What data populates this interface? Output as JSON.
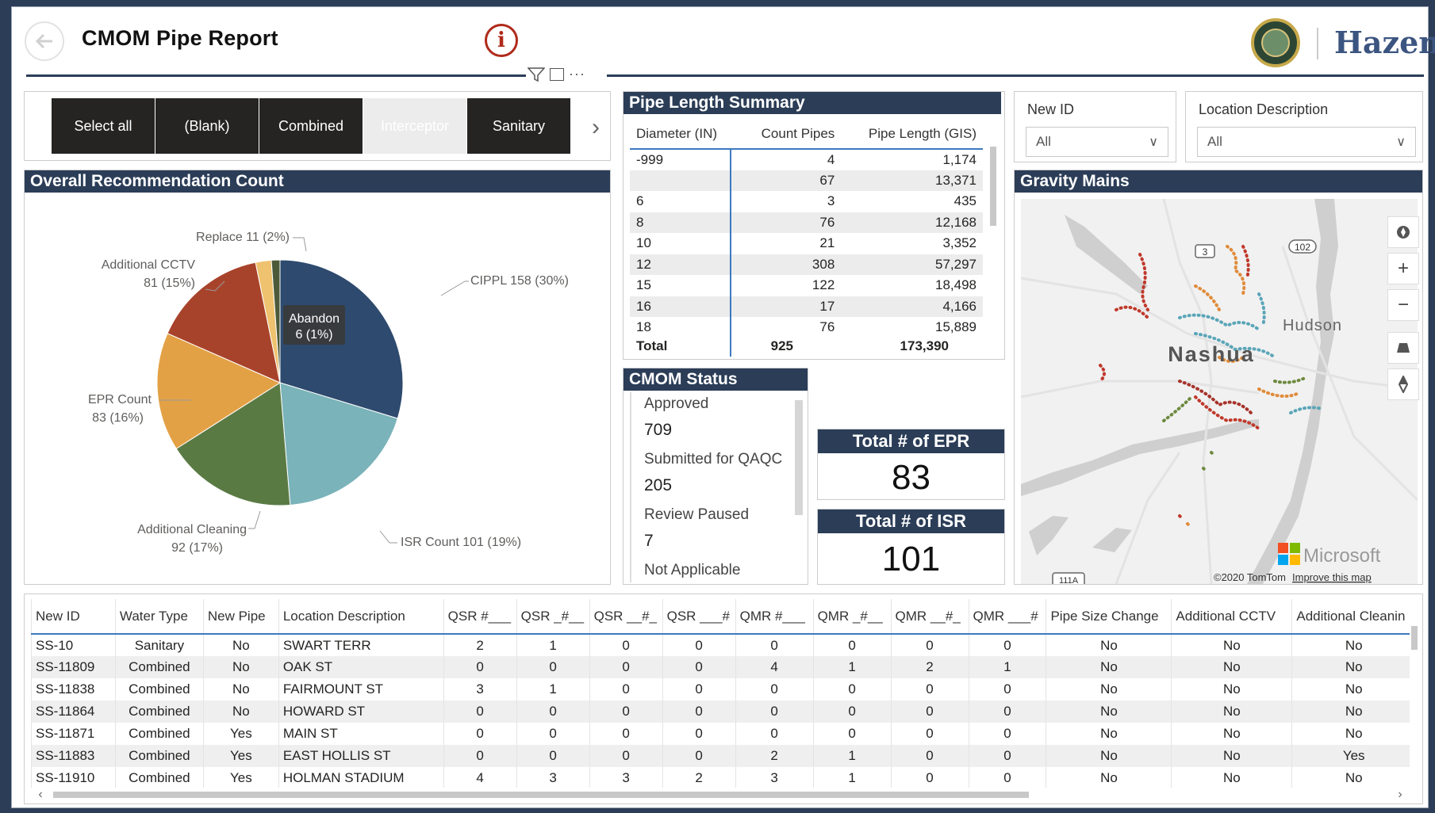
{
  "header": {
    "title": "CMOM Pipe Report",
    "logo_text": "Hazen",
    "info_icon": "info-circle-icon",
    "back_icon": "back-arrow-icon",
    "visual_menu": "···"
  },
  "water_type_slicer": {
    "options": [
      {
        "label": "Select all",
        "selected": true
      },
      {
        "label": "(Blank)",
        "selected": true
      },
      {
        "label": "Combined",
        "selected": true
      },
      {
        "label": "Interceptor",
        "selected": false
      },
      {
        "label": "Sanitary",
        "selected": true
      }
    ]
  },
  "pipe_length_summary": {
    "title": "Pipe Length Summary",
    "columns": [
      "Diameter (IN)",
      "Count Pipes",
      "Pipe Length (GIS)"
    ],
    "rows": [
      [
        "-999",
        "4",
        "1,174"
      ],
      [
        "",
        "67",
        "13,371"
      ],
      [
        "6",
        "3",
        "435"
      ],
      [
        "8",
        "76",
        "12,168"
      ],
      [
        "10",
        "21",
        "3,352"
      ],
      [
        "12",
        "308",
        "57,297"
      ],
      [
        "15",
        "122",
        "18,498"
      ],
      [
        "16",
        "17",
        "4,166"
      ],
      [
        "18",
        "76",
        "15,889"
      ]
    ],
    "total": [
      "Total",
      "925",
      "173,390"
    ]
  },
  "filters": {
    "new_id": {
      "label": "New ID",
      "value": "All"
    },
    "location_description": {
      "label": "Location Description",
      "value": "All"
    }
  },
  "recommendation": {
    "title": "Overall Recommendation Count",
    "tooltip_name": "Abandon",
    "tooltip_value": "6 (1%)",
    "labels": {
      "cippl": "CIPPL 158 (30%)",
      "isr": "ISR Count 101 (19%)",
      "cleaning_1": "Additional Cleaning",
      "cleaning_2": "92 (17%)",
      "epr_1": "EPR Count",
      "epr_2": "83 (16%)",
      "cctv_1": "Additional CCTV",
      "cctv_2": "81 (15%)",
      "replace": "Replace 11 (2%)"
    }
  },
  "chart_data": {
    "type": "pie",
    "title": "Overall Recommendation Count",
    "slices": [
      {
        "label": "CIPPL",
        "value": 158,
        "percent": 30,
        "color": "#2e4a6e"
      },
      {
        "label": "ISR Count",
        "value": 101,
        "percent": 19,
        "color": "#7ab3b9"
      },
      {
        "label": "Additional Cleaning",
        "value": 92,
        "percent": 17,
        "color": "#5a7a44"
      },
      {
        "label": "EPR Count",
        "value": 83,
        "percent": 16,
        "color": "#e3a145"
      },
      {
        "label": "Additional CCTV",
        "value": 81,
        "percent": 15,
        "color": "#a8432b"
      },
      {
        "label": "Replace",
        "value": 11,
        "percent": 2,
        "color": "#efc270"
      },
      {
        "label": "Abandon",
        "value": 6,
        "percent": 1,
        "color": "#4d5a3a"
      }
    ]
  },
  "cmom_status": {
    "title": "CMOM Status",
    "items": [
      {
        "label": "Approved",
        "value": "709"
      },
      {
        "label": "Submitted for QAQC",
        "value": "205"
      },
      {
        "label": "Review Paused",
        "value": "7"
      },
      {
        "label": "Not Applicable",
        "value": ""
      }
    ]
  },
  "cards": {
    "epr": {
      "title": "Total # of EPR",
      "value": "83"
    },
    "isr": {
      "title": "Total # of ISR",
      "value": "101"
    }
  },
  "map": {
    "title": "Gravity Mains",
    "city": "Nashua",
    "town": "Hudson",
    "road_3": "3",
    "road_102": "102",
    "road_111a": "111A",
    "brand": "Microsoft",
    "attribution": "©2020 TomTom",
    "improve_link": "Improve this map",
    "controls": [
      "+",
      "−"
    ]
  },
  "data_table": {
    "columns": [
      "New ID",
      "Water Type",
      "New Pipe",
      "Location Description",
      "QSR #___",
      "QSR _#__",
      "QSR __#_",
      "QSR ___#",
      "QMR #___",
      "QMR _#__",
      "QMR __#_",
      "QMR ___#",
      "Pipe Size Change",
      "Additional CCTV",
      "Additional Cleanin"
    ],
    "rows": [
      [
        "SS-10",
        "Sanitary",
        "No",
        "SWART TERR",
        "2",
        "1",
        "0",
        "0",
        "0",
        "0",
        "0",
        "0",
        "No",
        "No",
        "No"
      ],
      [
        "SS-11809",
        "Combined",
        "No",
        "OAK ST",
        "0",
        "0",
        "0",
        "0",
        "4",
        "1",
        "2",
        "1",
        "No",
        "No",
        "No"
      ],
      [
        "SS-11838",
        "Combined",
        "No",
        "FAIRMOUNT ST",
        "3",
        "1",
        "0",
        "0",
        "0",
        "0",
        "0",
        "0",
        "No",
        "No",
        "No"
      ],
      [
        "SS-11864",
        "Combined",
        "No",
        "HOWARD ST",
        "0",
        "0",
        "0",
        "0",
        "0",
        "0",
        "0",
        "0",
        "No",
        "No",
        "No"
      ],
      [
        "SS-11871",
        "Combined",
        "Yes",
        "MAIN ST",
        "0",
        "0",
        "0",
        "0",
        "0",
        "0",
        "0",
        "0",
        "No",
        "No",
        "No"
      ],
      [
        "SS-11883",
        "Combined",
        "Yes",
        "EAST HOLLIS ST",
        "0",
        "0",
        "0",
        "0",
        "2",
        "1",
        "0",
        "0",
        "No",
        "No",
        "Yes"
      ],
      [
        "SS-11910",
        "Combined",
        "Yes",
        "HOLMAN STADIUM",
        "4",
        "3",
        "3",
        "2",
        "3",
        "1",
        "0",
        "0",
        "No",
        "No",
        "No"
      ]
    ]
  }
}
